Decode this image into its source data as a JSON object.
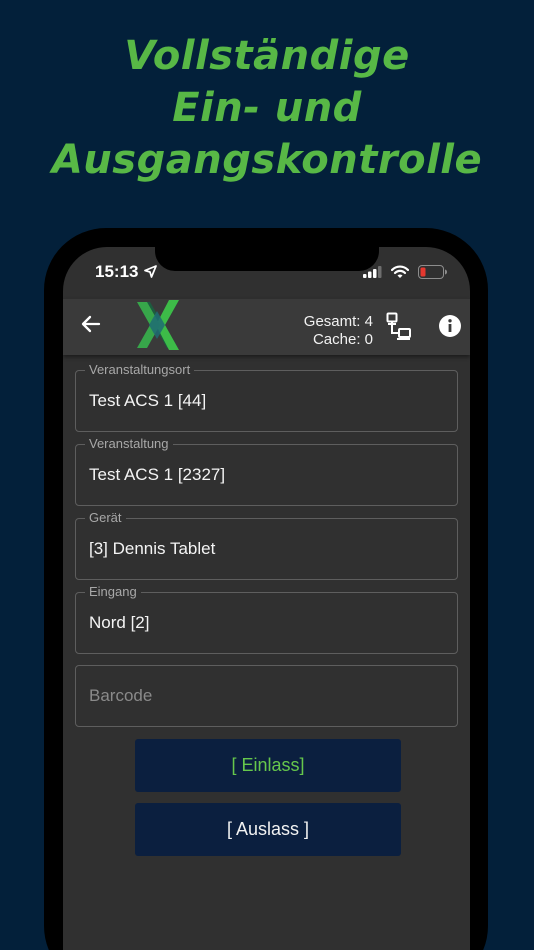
{
  "headline": {
    "line1": "Vollständige",
    "line2": "Ein- und",
    "line3": "Ausgangskontrolle"
  },
  "status_bar": {
    "time": "15:13"
  },
  "app_bar": {
    "total_label": "Gesamt: 4",
    "cache_label": "Cache: 0"
  },
  "form": {
    "venue": {
      "label": "Veranstaltungsort",
      "value": "Test ACS 1 [44]"
    },
    "event": {
      "label": "Veranstaltung",
      "value": "Test ACS 1 [2327]"
    },
    "device": {
      "label": "Gerät",
      "value": "[3] Dennis Tablet"
    },
    "entrance": {
      "label": "Eingang",
      "value": "Nord [2]"
    },
    "barcode": {
      "placeholder": "Barcode"
    }
  },
  "buttons": {
    "einlass": "[ Einlass]",
    "auslass": "[ Auslass ]"
  },
  "colors": {
    "background": "#03203a",
    "accent_green": "#58b846",
    "screen_bg": "#303030",
    "button_bg": "#0b1f3f"
  }
}
